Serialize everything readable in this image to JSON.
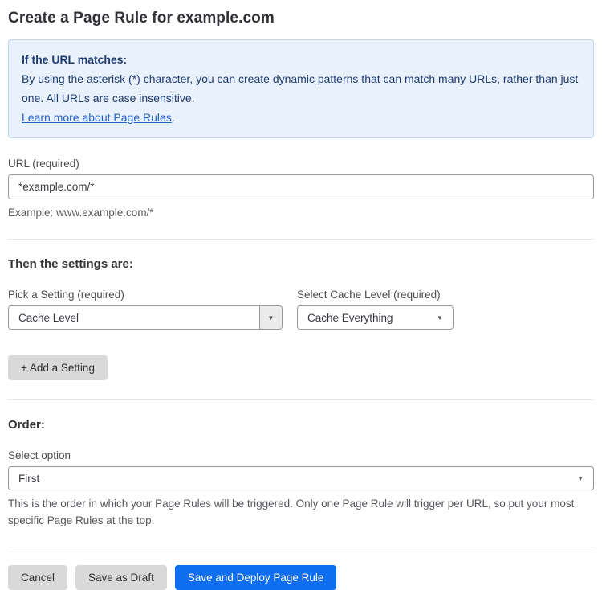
{
  "page": {
    "title": "Create a Page Rule for example.com"
  },
  "info_box": {
    "heading": "If the URL matches:",
    "body": "By using the asterisk (*) character, you can create dynamic patterns that can match many URLs, rather than just one. All URLs are case insensitive.",
    "link_label": "Learn more about Page Rules",
    "link_suffix": "."
  },
  "url_field": {
    "label": "URL (required)",
    "value": "*example.com/*",
    "hint": "Example: www.example.com/*"
  },
  "settings_section": {
    "heading": "Then the settings are:",
    "setting_picker": {
      "label": "Pick a Setting (required)",
      "value": "Cache Level"
    },
    "cache_level_picker": {
      "label": "Select Cache Level (required)",
      "value": "Cache Everything"
    },
    "add_setting_label": "+ Add a Setting"
  },
  "order_section": {
    "heading": "Order:",
    "label": "Select option",
    "value": "First",
    "hint": "This is the order in which your Page Rules will be triggered. Only one Page Rule will trigger per URL, so put your most specific Page Rules at the top."
  },
  "footer": {
    "cancel_label": "Cancel",
    "save_draft_label": "Save as Draft",
    "save_deploy_label": "Save and Deploy Page Rule"
  },
  "colors": {
    "accent_blue": "#0d6ef0",
    "info_background": "#e8f1fc",
    "info_border": "#bcd6f3",
    "info_text": "#1e3c72",
    "link_blue": "#2563c2",
    "button_gray": "#d9d9d9"
  },
  "icons": {
    "dropdown_arrow": "▼"
  }
}
